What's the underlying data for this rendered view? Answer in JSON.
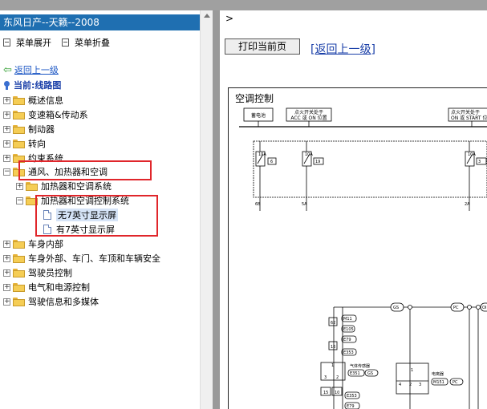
{
  "left": {
    "title": "东风日产--天籁--2008",
    "expand": "菜单展开",
    "collapse": "菜单折叠",
    "back": "返回上一级",
    "current": "当前:线路图",
    "tree": [
      {
        "label": "概述信息",
        "sign": "+"
      },
      {
        "label": "变速箱&传动系",
        "sign": "+"
      },
      {
        "label": "制动器",
        "sign": "+"
      },
      {
        "label": "转向",
        "sign": "+"
      },
      {
        "label": "约束系统",
        "sign": "+"
      },
      {
        "label": "通风、加热器和空调",
        "sign": "-"
      },
      {
        "label": "加热器和空调系统",
        "sign": "+"
      },
      {
        "label": "加热器和空调控制系统",
        "sign": "-"
      },
      {
        "label": "无7英寸显示屏"
      },
      {
        "label": "有7英寸显示屏"
      },
      {
        "label": "车身内部",
        "sign": "+"
      },
      {
        "label": "车身外部、车门、车顶和车辆安全",
        "sign": "+"
      },
      {
        "label": "驾驶员控制",
        "sign": "+"
      },
      {
        "label": "电气和电源控制",
        "sign": "+"
      },
      {
        "label": "驾驶信息和多媒体",
        "sign": "+"
      }
    ]
  },
  "right": {
    "gt": ">",
    "print": "打印当前页",
    "up": "[返回上一级]",
    "diagram": {
      "title": "空调控制",
      "boxes": [
        "蓄电池",
        "点火开关处于\nACC 或 ON 位置",
        "点火开关处于\nON 或 START 位"
      ],
      "fuses": [
        "10A\n6",
        "10A\n19",
        "10A\n3"
      ],
      "wire_labels": [
        "6B",
        "5A",
        "2A"
      ],
      "conn": [
        "M11",
        "62",
        "E105",
        "E79",
        "16",
        "E353",
        "1",
        "3",
        "2",
        "E351",
        "E353",
        "15",
        "10",
        "E79",
        "M151",
        "4",
        "2",
        "3"
      ],
      "components": [
        "气体传感器",
        "电离器"
      ],
      "tags": [
        "GS",
        "PC",
        "OI",
        "GS",
        "PC"
      ]
    }
  }
}
